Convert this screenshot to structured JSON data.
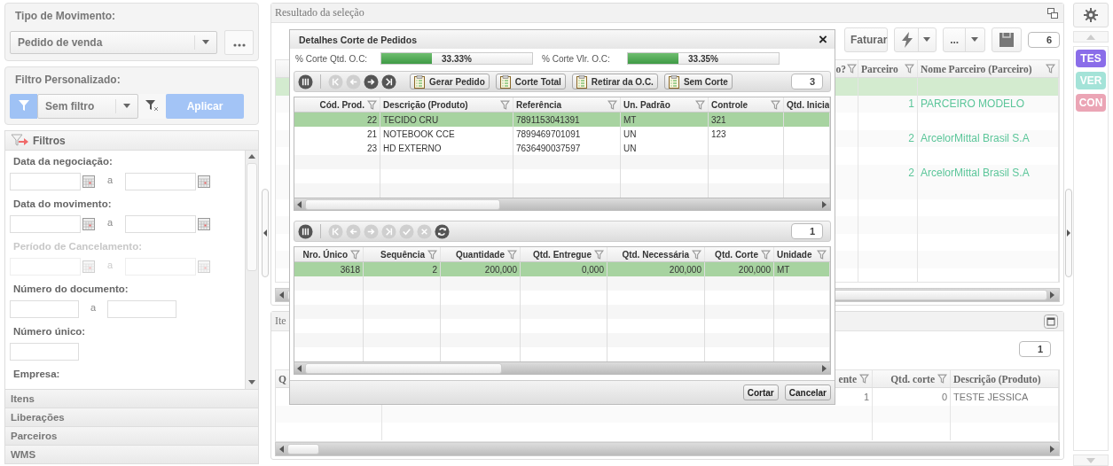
{
  "left_panel": {
    "movement_type": {
      "label": "Tipo de Movimento:",
      "value": "Pedido de venda"
    },
    "custom_filter": {
      "label": "Filtro Personalizado:",
      "value": "Sem filtro",
      "apply_button": "Aplicar"
    },
    "filters": {
      "title": "Filtros",
      "fields": [
        {
          "label": "Data da negociação:",
          "kind": "date_range",
          "separator": "a",
          "disabled": false
        },
        {
          "label": "Data do movimento:",
          "kind": "date_range",
          "separator": "a",
          "disabled": false
        },
        {
          "label": "Período de Cancelamento:",
          "kind": "date_range",
          "separator": "a",
          "disabled": true
        },
        {
          "label": "Número do documento:",
          "kind": "range",
          "separator": "a",
          "disabled": false
        },
        {
          "label": "Número único:",
          "kind": "single",
          "disabled": false
        },
        {
          "label": "Empresa:",
          "kind": "label",
          "disabled": false
        }
      ]
    },
    "sections": [
      "Itens",
      "Liberações",
      "Parceiros",
      "WMS"
    ]
  },
  "results_panel": {
    "title": "Resultado da seleção",
    "toolbar": {
      "invoice_button": "Faturar",
      "more_button": "...",
      "counter": "6"
    },
    "table": {
      "columns": [
        "o?",
        "Parceiro",
        "Nome Parceiro (Parceiro)"
      ],
      "rows": [
        {
          "selected": true
        },
        {
          "selected": false,
          "cells": {
            "1": "1",
            "2": "PARCEIRO MODELO"
          }
        },
        {
          "selected": false
        },
        {
          "selected": false,
          "cells": {
            "1": "2",
            "2": "ArcelorMittal Brasil S.A"
          }
        },
        {
          "selected": false
        },
        {
          "selected": false,
          "cells": {
            "1": "2",
            "2": "ArcelorMittal Brasil S.A"
          }
        }
      ]
    }
  },
  "items_panel": {
    "title": "Ite",
    "counter": "1",
    "table": {
      "columns": [
        "Q",
        "ente",
        "Qtd. corte",
        "Descrição (Produto)"
      ],
      "rows": [
        {
          "cells": {
            "1": "1",
            "2": "0",
            "3": "TESTE JESSICA"
          }
        }
      ]
    }
  },
  "dialog": {
    "title": "Detalhes Corte de Pedidos",
    "close": "×",
    "meters": [
      {
        "label": "% Corte Qtd. O.C:",
        "level": 0.3333,
        "reading": "33.33%"
      },
      {
        "label": "% Corte Vlr. O.C:",
        "level": 0.3335,
        "reading": "33.35%"
      }
    ],
    "orders_toolbar": {
      "nav_buttons": [
        {
          "kind": "columns",
          "disabled": false
        },
        {
          "kind": "first",
          "disabled": true
        },
        {
          "kind": "previous",
          "disabled": true
        },
        {
          "kind": "next",
          "disabled": false
        },
        {
          "kind": "last",
          "disabled": false
        }
      ],
      "actions": [
        "Gerar Pedido",
        "Corte Total",
        "Retirar da O.C.",
        "Sem Corte"
      ],
      "counter": "3"
    },
    "orders_table": {
      "columns": [
        "Cód. Prod.",
        "Descrição (Produto)",
        "Referência",
        "Un. Padrão",
        "Controle",
        "Qtd. Inicia"
      ],
      "rows": [
        {
          "selected": true,
          "cells": [
            "22",
            "TECIDO CRU",
            "7891153041391",
            "MT",
            "321"
          ]
        },
        {
          "selected": false,
          "cells": [
            "21",
            "NOTEBOOK CCE",
            "7899469701091",
            "UN",
            "123"
          ]
        },
        {
          "selected": false,
          "cells": [
            "23",
            "HD EXTERNO",
            "7636490037597",
            "UN"
          ]
        }
      ]
    },
    "cuts_toolbar": {
      "nav_buttons": [
        {
          "kind": "columns",
          "disabled": false
        },
        {
          "kind": "first",
          "disabled": true
        },
        {
          "kind": "previous",
          "disabled": true
        },
        {
          "kind": "next",
          "disabled": true
        },
        {
          "kind": "last",
          "disabled": true
        },
        {
          "kind": "confirm",
          "disabled": true
        },
        {
          "kind": "cancel",
          "disabled": true
        },
        {
          "kind": "refresh",
          "disabled": false
        }
      ],
      "counter": "1"
    },
    "cuts_table": {
      "columns": [
        "Nro. Único",
        "Sequência",
        "Quantidade",
        "Qtd. Entregue",
        "Qtd. Necessária",
        "Qtd. Corte",
        "Unidade"
      ],
      "rows": [
        {
          "selected": true,
          "cells": [
            "3618",
            "2",
            "200,000",
            "0,000",
            "200,000",
            "200,000",
            "MT"
          ]
        }
      ]
    },
    "buttons": [
      "Cortar",
      "Cancelar"
    ]
  },
  "sidebar": {
    "badges": [
      {
        "label": "TES",
        "color": "#8a6de9"
      },
      {
        "label": "VER",
        "color": "#a4e3d8"
      },
      {
        "label": "CON",
        "color": "#eba5b5"
      }
    ]
  }
}
